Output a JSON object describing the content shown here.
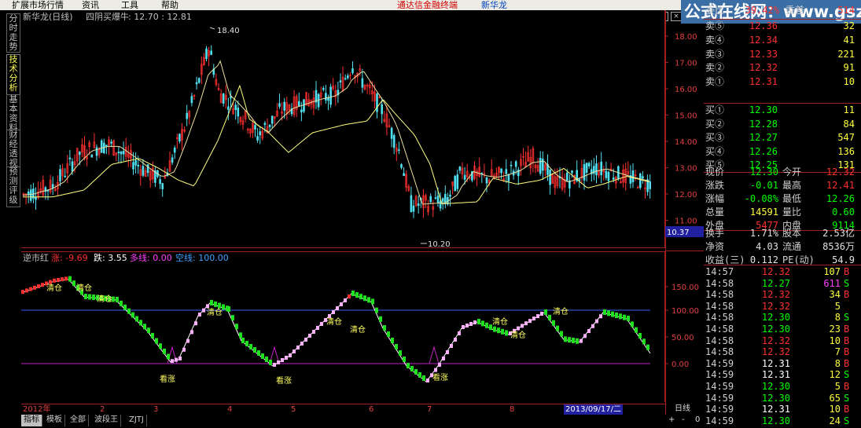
{
  "menu": [
    "扩展市场行情",
    "资讯",
    "工具",
    "帮助"
  ],
  "app_title": "通达信金融终端",
  "stock_name": "新华龙",
  "watermark": "公式在线网：www.gszx.com.cn",
  "window_buttons": [
    "_",
    "□",
    "×"
  ],
  "left_tabs": [
    {
      "label": "分时走势",
      "active": false
    },
    {
      "label": "技术分析",
      "active": true
    },
    {
      "label": "基本资料",
      "active": false
    },
    {
      "label": "财经透视",
      "active": false
    },
    {
      "label": "预测评级",
      "active": false
    }
  ],
  "main_chart": {
    "header_name": "新华龙(日线)",
    "header_formula": "四阴买爆牛",
    "header_values": ": 12.70 : 12.81",
    "high_label": "18.40",
    "low_label": "10.20",
    "y_ticks": [
      "18.00",
      "17.00",
      "16.00",
      "15.00",
      "14.00",
      "13.00",
      "12.00",
      "11.00"
    ],
    "cursor_value": "10.37"
  },
  "indicator": {
    "name": "逆市红",
    "items": [
      {
        "label": "涨: -9.69",
        "color": "#ff3030"
      },
      {
        "label": "跌: 3.55",
        "color": "#ffffff"
      },
      {
        "label": "多线: 0.00",
        "color": "#ff40ff"
      },
      {
        "label": "空线: 100.00",
        "color": "#40a0ff"
      }
    ],
    "y_ticks": [
      "150.00",
      "100.00",
      "50.00",
      "0.00"
    ],
    "labels": {
      "clear": "清仓",
      "rise": "看涨"
    }
  },
  "date_axis": [
    "2012年",
    "2",
    "3",
    "4",
    "5",
    "6",
    "7",
    "8",
    "2013/09/17/二"
  ],
  "period": "日线",
  "bottom_tabs": [
    {
      "label": "指标",
      "active": true
    },
    {
      "label": "模板",
      "active": false
    },
    {
      "label": "全部",
      "active": false
    },
    {
      "label": "波段王",
      "active": false
    },
    {
      "label": "ZJTJ",
      "active": false
    }
  ],
  "scroll_buttons": [
    "+",
    "-",
    "0"
  ],
  "quote": {
    "ratio_label": "委比",
    "ratio_value": "39.42%",
    "diff_label": "委差",
    "diff_value": "514",
    "sells": [
      {
        "label": "卖⑤",
        "price": "12.36",
        "vol": "32"
      },
      {
        "label": "卖④",
        "price": "12.34",
        "vol": "41"
      },
      {
        "label": "卖③",
        "price": "12.33",
        "vol": "221"
      },
      {
        "label": "卖②",
        "price": "12.32",
        "vol": "91"
      },
      {
        "label": "卖①",
        "price": "12.31",
        "vol": "10"
      }
    ],
    "buys": [
      {
        "label": "买①",
        "price": "12.30",
        "vol": "11"
      },
      {
        "label": "买②",
        "price": "12.28",
        "vol": "84"
      },
      {
        "label": "买③",
        "price": "12.27",
        "vol": "547"
      },
      {
        "label": "买④",
        "price": "12.26",
        "vol": "136"
      },
      {
        "label": "买⑤",
        "price": "12.25",
        "vol": "131"
      }
    ],
    "stats": [
      [
        {
          "l": "现价",
          "v": "12.30",
          "c": "#00ff00"
        },
        {
          "l": "今开",
          "v": "12.32",
          "c": "#ff3030"
        }
      ],
      [
        {
          "l": "涨跌",
          "v": "-0.01",
          "c": "#00ff00"
        },
        {
          "l": "最高",
          "v": "12.41",
          "c": "#ff3030"
        }
      ],
      [
        {
          "l": "涨幅",
          "v": "-0.08%",
          "c": "#00ff00"
        },
        {
          "l": "最低",
          "v": "12.26",
          "c": "#00ff00"
        }
      ],
      [
        {
          "l": "总量",
          "v": "14591",
          "c": "#ffff40"
        },
        {
          "l": "量比",
          "v": "0.60",
          "c": "#00ff00"
        }
      ],
      [
        {
          "l": "外盘",
          "v": "5477",
          "c": "#ff3030"
        },
        {
          "l": "内盘",
          "v": "9114",
          "c": "#00ff00"
        }
      ]
    ],
    "info": [
      [
        {
          "l": "换手",
          "v": "1.71%"
        },
        {
          "l": "股本",
          "v": "2.53亿"
        }
      ],
      [
        {
          "l": "净资",
          "v": "4.03"
        },
        {
          "l": "流通",
          "v": "8536万"
        }
      ],
      [
        {
          "l": "收益(三)",
          "v": "0.112"
        },
        {
          "l": "PE(动)",
          "v": "54.9"
        }
      ]
    ],
    "ticks": [
      {
        "t": "14:57",
        "p": "12.32",
        "pc": "#ff3030",
        "v": "107",
        "vc": "#ffff40",
        "s": "B"
      },
      {
        "t": "14:58",
        "p": "12.27",
        "pc": "#00ff00",
        "v": "611",
        "vc": "#ff40ff",
        "s": "S"
      },
      {
        "t": "14:58",
        "p": "12.32",
        "pc": "#ff3030",
        "v": "34",
        "vc": "#ffff40",
        "s": "B"
      },
      {
        "t": "14:58",
        "p": "12.32",
        "pc": "#ff3030",
        "v": "5",
        "vc": "#ffff40",
        "s": ""
      },
      {
        "t": "14:58",
        "p": "12.30",
        "pc": "#00ff00",
        "v": "8",
        "vc": "#ffff40",
        "s": "S"
      },
      {
        "t": "14:58",
        "p": "12.30",
        "pc": "#00ff00",
        "v": "23",
        "vc": "#ffff40",
        "s": "B"
      },
      {
        "t": "14:58",
        "p": "12.32",
        "pc": "#ff3030",
        "v": "10",
        "vc": "#ffff40",
        "s": "B"
      },
      {
        "t": "14:58",
        "p": "12.32",
        "pc": "#ff3030",
        "v": "7",
        "vc": "#ffff40",
        "s": "B"
      },
      {
        "t": "14:59",
        "p": "12.31",
        "pc": "#ffffff",
        "v": "8",
        "vc": "#ffff40",
        "s": "B"
      },
      {
        "t": "14:59",
        "p": "12.31",
        "pc": "#ffffff",
        "v": "12",
        "vc": "#ffff40",
        "s": "S"
      },
      {
        "t": "14:59",
        "p": "12.30",
        "pc": "#00ff00",
        "v": "5",
        "vc": "#ffff40",
        "s": "B"
      },
      {
        "t": "14:59",
        "p": "12.30",
        "pc": "#00ff00",
        "v": "65",
        "vc": "#ffff40",
        "s": "S"
      },
      {
        "t": "14:59",
        "p": "12.31",
        "pc": "#ffffff",
        "v": "10",
        "vc": "#ffff40",
        "s": "B"
      },
      {
        "t": "14:59",
        "p": "12.30",
        "pc": "#00ff00",
        "v": "24",
        "vc": "#ffff40",
        "s": "S"
      }
    ]
  }
}
